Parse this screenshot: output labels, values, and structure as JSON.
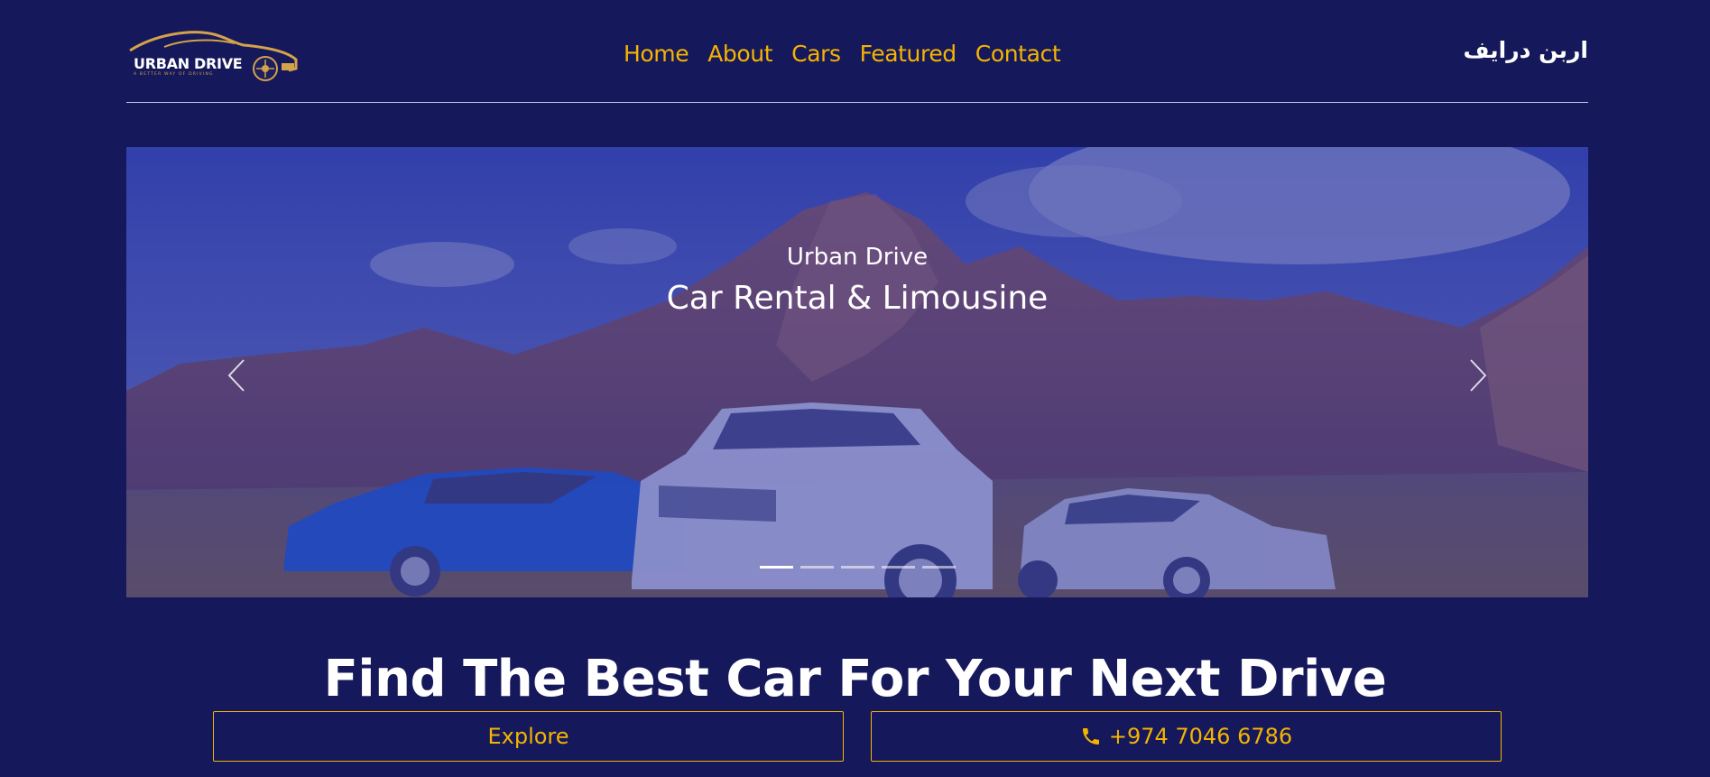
{
  "header": {
    "logo": {
      "name": "URBAN DRIVE",
      "tagline": "A Better Way of Driving"
    },
    "nav": [
      {
        "label": "Home"
      },
      {
        "label": "About"
      },
      {
        "label": "Cars"
      },
      {
        "label": "Featured"
      },
      {
        "label": "Contact"
      }
    ],
    "brand_arabic": "اربن درايف"
  },
  "hero": {
    "kicker": "Urban Drive",
    "title": "Car Rental & Limousine",
    "slide_count": 5,
    "active_slide": 1,
    "icons": {
      "prev": "chevron-left-icon",
      "next": "chevron-right-icon"
    }
  },
  "main": {
    "headline": "Find The Best Car For Your Next Drive",
    "explore_label": "Explore",
    "phone_label": "+974 7046 6786",
    "phone_icon": "phone-icon"
  },
  "colors": {
    "background": "#15185a",
    "accent": "#f5b400",
    "text": "#ffffff"
  }
}
